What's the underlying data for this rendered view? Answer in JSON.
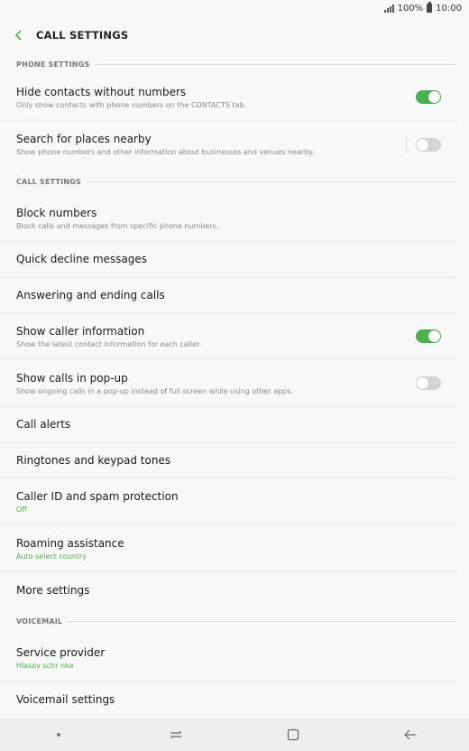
{
  "status": {
    "battery": "100%",
    "time": "10:00"
  },
  "appbar": {
    "title": "CALL SETTINGS"
  },
  "sections": {
    "phone": "PHONE SETTINGS",
    "call": "CALL SETTINGS",
    "voicemail": "VOICEMAIL"
  },
  "items": {
    "hide_contacts": {
      "title": "Hide contacts without numbers",
      "sub": "Only show contacts with phone numbers on the CONTACTS tab.",
      "toggle": "on"
    },
    "search_places": {
      "title": "Search for places nearby",
      "sub": "Show phone numbers and other information about businesses and venues nearby.",
      "toggle": "off"
    },
    "block_numbers": {
      "title": "Block numbers",
      "sub": "Block calls and messages from specific phone numbers."
    },
    "quick_decline": {
      "title": "Quick decline messages"
    },
    "answering": {
      "title": "Answering and ending calls"
    },
    "caller_info": {
      "title": "Show caller information",
      "sub": "Show the latest contact information for each caller.",
      "toggle": "on"
    },
    "popup": {
      "title": "Show calls in pop-up",
      "sub": "Show ongoing calls in a pop-up instead of full screen while using other apps.",
      "toggle": "off"
    },
    "call_alerts": {
      "title": "Call alerts"
    },
    "ringtones": {
      "title": "Ringtones and keypad tones"
    },
    "caller_id": {
      "title": "Caller ID and spam protection",
      "sub": "Off"
    },
    "roaming": {
      "title": "Roaming assistance",
      "sub": "Auto select country"
    },
    "more": {
      "title": "More settings"
    },
    "provider": {
      "title": "Service provider",
      "sub": "Hlasov  schr nka"
    },
    "voicemail_settings": {
      "title": "Voicemail settings"
    }
  },
  "colors": {
    "accent": "#4caf50",
    "toggle_off": "#d4d4d4"
  }
}
